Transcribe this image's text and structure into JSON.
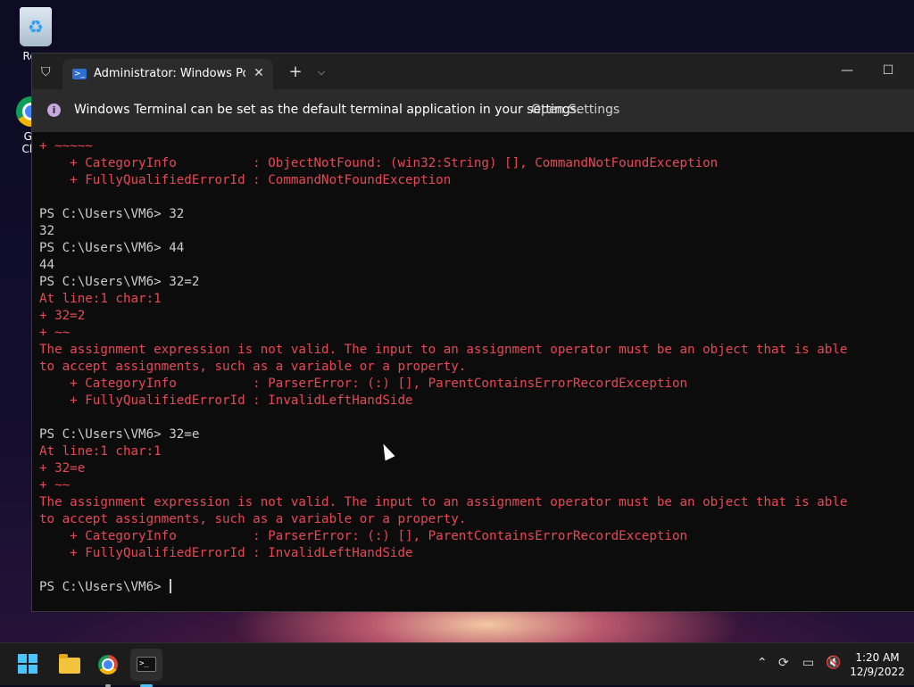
{
  "desktop": {
    "icons": [
      {
        "label": "Recy"
      },
      {
        "label_line1": "Go",
        "label_line2": "Chr"
      }
    ]
  },
  "window": {
    "tab_title": "Administrator: Windows PowerShell",
    "new_tab": "+",
    "dropdown": "⌵",
    "minimize": "—",
    "maximize": "☐"
  },
  "infobar": {
    "message": "Windows Terminal can be set as the default terminal application in your settings.",
    "link": "Open Settings"
  },
  "console": {
    "lines": [
      {
        "text": "+ ~~~~~",
        "style": "err"
      },
      {
        "text": "    + CategoryInfo          : ObjectNotFound: (win32:String) [], CommandNotFoundException",
        "style": "err"
      },
      {
        "text": "    + FullyQualifiedErrorId : CommandNotFoundException",
        "style": "err"
      },
      {
        "text": "",
        "style": "out"
      },
      {
        "text": "PS C:\\Users\\VM6> 32",
        "style": "out"
      },
      {
        "text": "32",
        "style": "out"
      },
      {
        "text": "PS C:\\Users\\VM6> 44",
        "style": "out"
      },
      {
        "text": "44",
        "style": "out"
      },
      {
        "text": "PS C:\\Users\\VM6> 32=2",
        "style": "out"
      },
      {
        "text": "At line:1 char:1",
        "style": "err"
      },
      {
        "text": "+ 32=2",
        "style": "err"
      },
      {
        "text": "+ ~~",
        "style": "err"
      },
      {
        "text": "The assignment expression is not valid. The input to an assignment operator must be an object that is able",
        "style": "err"
      },
      {
        "text": "to accept assignments, such as a variable or a property.",
        "style": "err"
      },
      {
        "text": "    + CategoryInfo          : ParserError: (:) [], ParentContainsErrorRecordException",
        "style": "err"
      },
      {
        "text": "    + FullyQualifiedErrorId : InvalidLeftHandSide",
        "style": "err"
      },
      {
        "text": "",
        "style": "out"
      },
      {
        "text": "PS C:\\Users\\VM6> 32=e",
        "style": "out"
      },
      {
        "text": "At line:1 char:1",
        "style": "err"
      },
      {
        "text": "+ 32=e",
        "style": "err"
      },
      {
        "text": "+ ~~",
        "style": "err"
      },
      {
        "text": "The assignment expression is not valid. The input to an assignment operator must be an object that is able",
        "style": "err"
      },
      {
        "text": "to accept assignments, such as a variable or a property.",
        "style": "err"
      },
      {
        "text": "    + CategoryInfo          : ParserError: (:) [], ParentContainsErrorRecordException",
        "style": "err"
      },
      {
        "text": "    + FullyQualifiedErrorId : InvalidLeftHandSide",
        "style": "err"
      },
      {
        "text": "",
        "style": "out"
      }
    ],
    "prompt": "PS C:\\Users\\VM6> "
  },
  "taskbar": {
    "apps": [
      "start",
      "file-explorer",
      "chrome",
      "terminal"
    ],
    "time": "1:20 AM",
    "date": "12/9/2022"
  },
  "colors": {
    "error": "#e74856",
    "text": "#cccccc",
    "accent": "#4cc2ff"
  }
}
